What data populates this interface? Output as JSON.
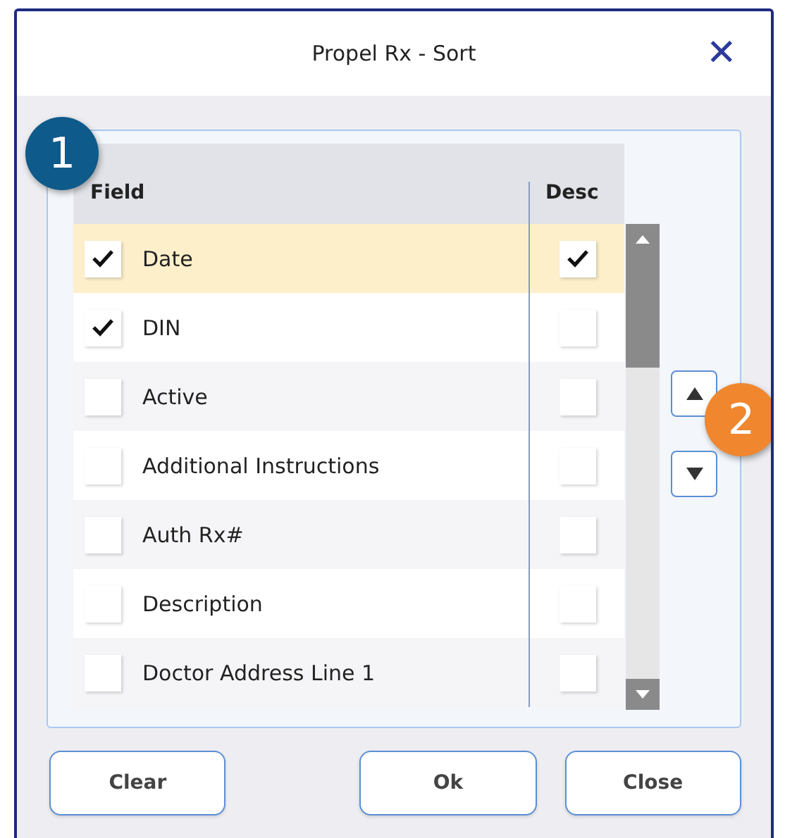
{
  "window": {
    "title": "Propel Rx - Sort",
    "close": "✕"
  },
  "badges": [
    {
      "label": "1",
      "color": "#0e5a8a"
    },
    {
      "label": "2",
      "color": "#f0862e"
    }
  ],
  "table": {
    "columns": [
      "Field",
      "Desc"
    ],
    "rows": [
      {
        "field": "Date",
        "included": true,
        "descending": true,
        "selected": true
      },
      {
        "field": "DIN",
        "included": true,
        "descending": false,
        "selected": false
      },
      {
        "field": "Active",
        "included": false,
        "descending": false,
        "selected": false
      },
      {
        "field": "Additional Instructions",
        "included": false,
        "descending": false,
        "selected": false
      },
      {
        "field": "Auth Rx#",
        "included": false,
        "descending": false,
        "selected": false
      },
      {
        "field": "Description",
        "included": false,
        "descending": false,
        "selected": false
      },
      {
        "field": "Doctor Address Line 1",
        "included": false,
        "descending": false,
        "selected": false
      }
    ]
  },
  "buttons": [
    "Clear",
    "Ok",
    "Close"
  ]
}
